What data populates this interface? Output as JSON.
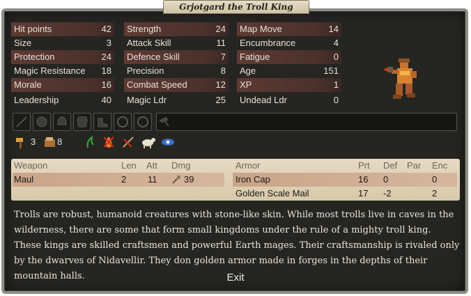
{
  "window": {
    "title": "Grjotgard the Troll King"
  },
  "stats": {
    "col1": [
      {
        "label": "Hit points",
        "value": "42"
      },
      {
        "label": "Size",
        "value": "3"
      },
      {
        "label": "Protection",
        "value": "24"
      },
      {
        "label": "Magic Resistance",
        "value": "18"
      },
      {
        "label": "Morale",
        "value": "16"
      },
      {
        "label": "Leadership",
        "value": "40"
      }
    ],
    "col2": [
      {
        "label": "Strength",
        "value": "24"
      },
      {
        "label": "Attack Skill",
        "value": "11"
      },
      {
        "label": "Defence Skill",
        "value": "7"
      },
      {
        "label": "Precision",
        "value": "8"
      },
      {
        "label": "Combat Speed",
        "value": "12"
      },
      {
        "label": "Magic Ldr",
        "value": "25"
      }
    ],
    "col3": [
      {
        "label": "Map Move",
        "value": "14"
      },
      {
        "label": "Encumbrance",
        "value": "4"
      },
      {
        "label": "Fatigue",
        "value": "0"
      },
      {
        "label": "Age",
        "value": "151"
      },
      {
        "label": "XP",
        "value": "1"
      },
      {
        "label": "Undead Ldr",
        "value": "0"
      }
    ]
  },
  "abilities": {
    "earth_value": "3",
    "items_value": "8"
  },
  "weapons": {
    "headers": {
      "name": "Weapon",
      "len": "Len",
      "att": "Att",
      "dmg": "Dmg"
    },
    "rows": [
      {
        "name": "Maul",
        "len": "2",
        "att": "11",
        "dmg": "39"
      }
    ]
  },
  "armor": {
    "headers": {
      "name": "Armor",
      "prt": "Prt",
      "def": "Def",
      "par": "Par",
      "enc": "Enc"
    },
    "rows": [
      {
        "name": "Iron Cap",
        "prt": "16",
        "def": "0",
        "par": "",
        "enc": "0"
      },
      {
        "name": "Golden Scale Mail",
        "prt": "17",
        "def": "-2",
        "par": "",
        "enc": "2"
      }
    ]
  },
  "description": "Trolls are robust, humanoid creatures with stone-like skin. While most trolls live in caves in the wilderness, there are some that form small kingdoms under the rule of a mighty troll king. These kings are skilled craftsmen and powerful Earth mages. Their craftsmanship is rivaled only by the dwarves of Nidavellir. They don golden armor made in forges in the depths of their mountain halls.",
  "exit_label": "Exit",
  "icons": [
    "hammer-icon",
    "items-icon",
    "herb-icon",
    "fire-immunity-icon",
    "weapon-crossed-icon",
    "goat-icon",
    "eye-icon"
  ]
}
